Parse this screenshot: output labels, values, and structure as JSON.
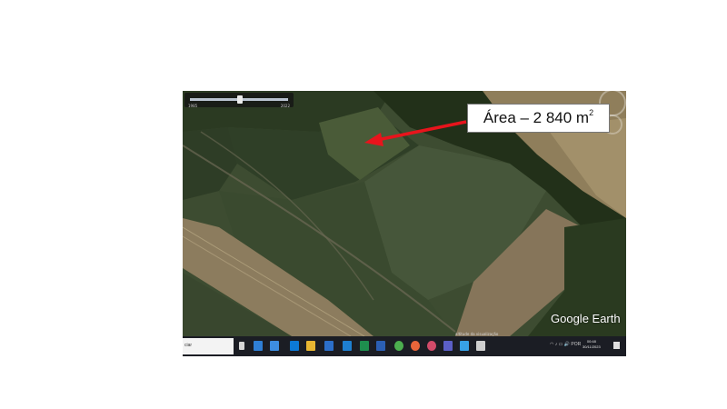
{
  "annotation": {
    "area_label": "Área – 2 840 m",
    "area_superscript": "2",
    "arrow_color": "#e8141c"
  },
  "map": {
    "logo": "Google Earth",
    "status_text": "altitude da visualização",
    "slider_start": "1985",
    "slider_end": "2022"
  },
  "taskbar": {
    "search_label": "ciar",
    "tray_text": "◠ ♪ ▭ 🔊 POR",
    "clock_time": "00:48",
    "clock_date": "30/11/2023",
    "icons": [
      "start-icon",
      "search-icon",
      "task-view-icon",
      "edge-icon",
      "file-explorer-icon",
      "mail-icon",
      "store-icon",
      "excel-icon",
      "word-icon",
      "chrome-icon",
      "firefox-icon",
      "app-icon",
      "teams-icon",
      "photos-icon",
      "google-earth-icon"
    ]
  },
  "colors": {
    "field_dark": "#35452a",
    "field_light": "#5a6a45",
    "bare_soil": "#8a7a5c",
    "taskbar": "#1b1d24"
  }
}
